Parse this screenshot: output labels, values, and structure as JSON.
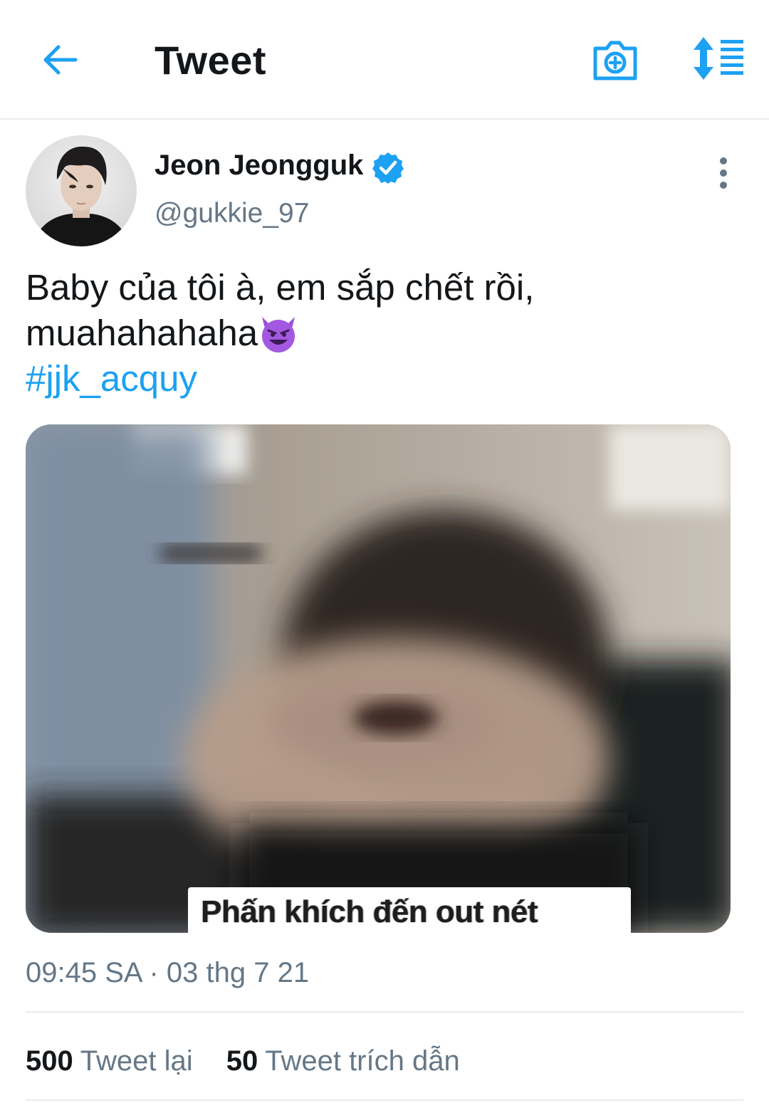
{
  "header": {
    "title": "Tweet",
    "back_icon": "arrow-left-icon",
    "camera_icon": "camera-add-icon",
    "sort_icon": "sort-icon",
    "accent_color": "#1da1f2"
  },
  "tweet": {
    "author_name": "Jeon Jeongguk",
    "verified": true,
    "handle": "@gukkie_97",
    "text_line1": "Baby của tôi à, em sắp chết rồi,",
    "text_line2": "muahahahaha",
    "emoji": "smiling-devil-emoji",
    "hashtag": "#jjk_acquy",
    "media_caption": "Phấn khích đến out nét",
    "timestamp": "09:45 SA · 03 thg 7 21"
  },
  "stats": {
    "retweets_count": "500",
    "retweets_label": "Tweet lại",
    "quotes_count": "50",
    "quotes_label": "Tweet trích dẫn"
  }
}
